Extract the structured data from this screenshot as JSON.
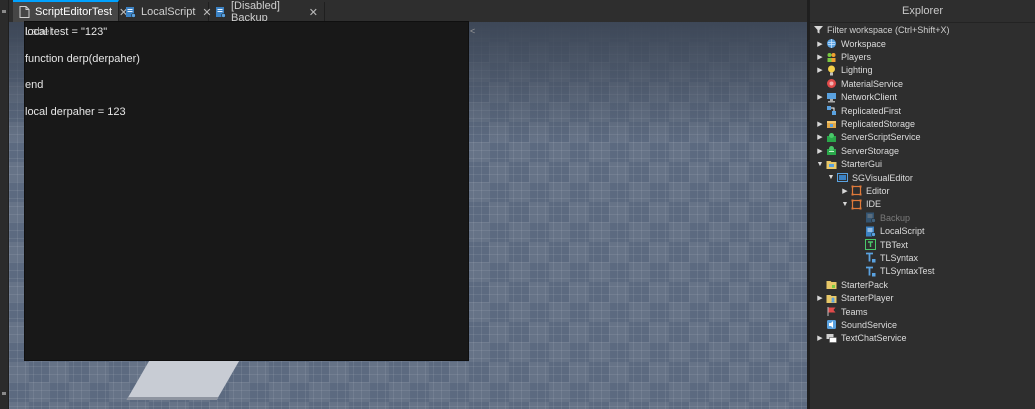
{
  "tabs": [
    {
      "label": "ScriptEditorTest",
      "close": "✕",
      "active": true
    },
    {
      "label": "LocalScript",
      "close": "✕",
      "active": false
    },
    {
      "label": "[Disabled] Backup",
      "close": "✕",
      "active": false
    }
  ],
  "editor": {
    "ghost_text": "Label",
    "lines": [
      "local test = \"123\"",
      "function derp(derpaher)",
      "end",
      "local derpaher = 123"
    ],
    "caret_mark": "<"
  },
  "explorer": {
    "title": "Explorer",
    "filter_placeholder": "Filter workspace (Ctrl+Shift+X)",
    "items": [
      {
        "label": "Workspace",
        "arrow": "▶",
        "icon": "workspace-icon"
      },
      {
        "label": "Players",
        "arrow": "▶",
        "icon": "players-icon"
      },
      {
        "label": "Lighting",
        "arrow": "▶",
        "icon": "lighting-icon"
      },
      {
        "label": "MaterialService",
        "arrow": "",
        "icon": "material-service-icon"
      },
      {
        "label": "NetworkClient",
        "arrow": "▶",
        "icon": "network-client-icon"
      },
      {
        "label": "ReplicatedFirst",
        "arrow": "",
        "icon": "replicated-first-icon"
      },
      {
        "label": "ReplicatedStorage",
        "arrow": "▶",
        "icon": "replicated-storage-icon"
      },
      {
        "label": "ServerScriptService",
        "arrow": "▶",
        "icon": "server-script-service-icon"
      },
      {
        "label": "ServerStorage",
        "arrow": "▶",
        "icon": "server-storage-icon"
      },
      {
        "label": "StarterGui",
        "arrow": "▼",
        "icon": "starter-gui-icon"
      },
      {
        "label": "SGVisualEditor",
        "arrow": "▼",
        "icon": "screen-gui-icon"
      },
      {
        "label": "Editor",
        "arrow": "▶",
        "icon": "frame-icon"
      },
      {
        "label": "IDE",
        "arrow": "▼",
        "icon": "frame-icon"
      },
      {
        "label": "Backup",
        "arrow": "",
        "icon": "local-script-icon",
        "disabled": true
      },
      {
        "label": "LocalScript",
        "arrow": "",
        "icon": "local-script-icon"
      },
      {
        "label": "TBText",
        "arrow": "",
        "icon": "text-box-icon"
      },
      {
        "label": "TLSyntax",
        "arrow": "",
        "icon": "text-label-icon"
      },
      {
        "label": "TLSyntaxTest",
        "arrow": "",
        "icon": "text-label-icon"
      },
      {
        "label": "StarterPack",
        "arrow": "",
        "icon": "starter-pack-icon"
      },
      {
        "label": "StarterPlayer",
        "arrow": "▶",
        "icon": "starter-player-icon"
      },
      {
        "label": "Teams",
        "arrow": "",
        "icon": "teams-icon"
      },
      {
        "label": "SoundService",
        "arrow": "",
        "icon": "sound-service-icon"
      },
      {
        "label": "TextChatService",
        "arrow": "▶",
        "icon": "text-chat-service-icon"
      }
    ]
  },
  "colors": {
    "accent": "#00a2ff",
    "code_bg": "#181818",
    "viewport": "#5c6a80"
  }
}
